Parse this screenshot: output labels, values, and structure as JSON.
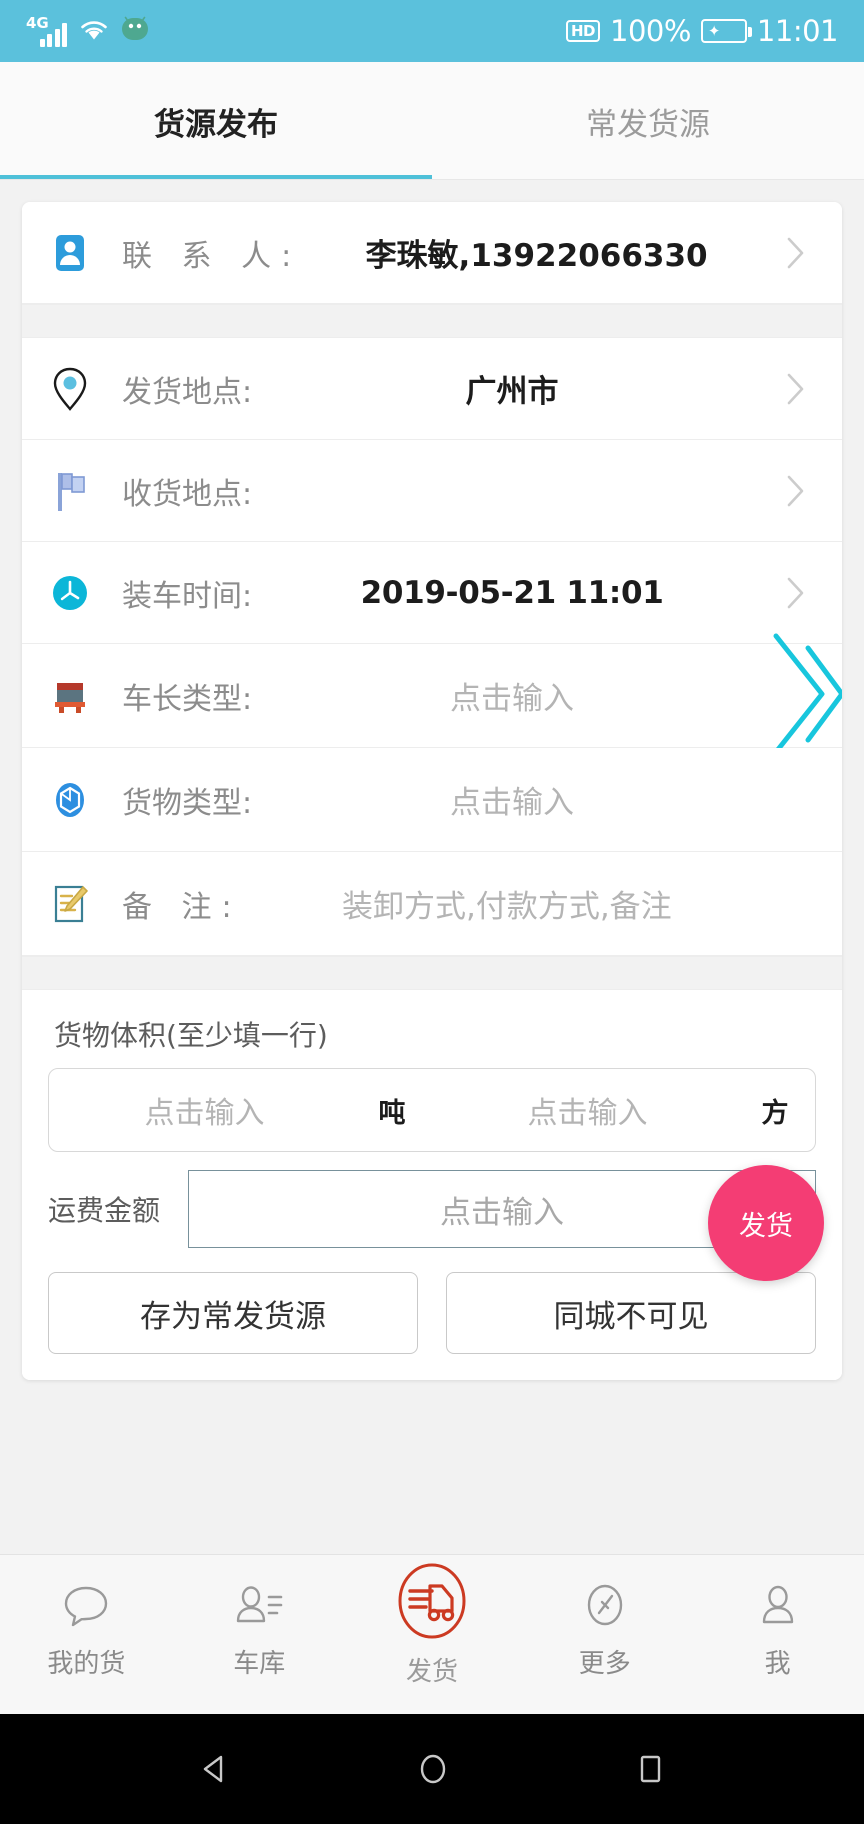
{
  "status_bar": {
    "network_type": "4G",
    "hd_label": "HD",
    "battery_percent": "100%",
    "time": "11:01",
    "icons": [
      "signal-icon",
      "wifi-icon",
      "android-robot-icon",
      "hd-icon",
      "battery-icon"
    ]
  },
  "tabs": [
    {
      "label": "货源发布",
      "active": true
    },
    {
      "label": "常发货源",
      "active": false
    }
  ],
  "form": {
    "rows": [
      {
        "icon": "contact-person-icon",
        "label": "联 系 人:",
        "value": "李珠敏,13922066330",
        "placeholder": "",
        "chevron": true
      },
      {
        "icon": "location-pin-icon",
        "label": "发货地点:",
        "value": "广州市",
        "placeholder": "",
        "chevron": true
      },
      {
        "icon": "flag-icon",
        "label": "收货地点:",
        "value": "",
        "placeholder": "",
        "chevron": true
      },
      {
        "icon": "clock-icon",
        "label": "装车时间:",
        "value": "2019-05-21 11:01",
        "placeholder": "",
        "chevron": true
      },
      {
        "icon": "truck-icon",
        "label": "车长类型:",
        "value": "",
        "placeholder": "点击输入",
        "chevron": false
      },
      {
        "icon": "cargo-box-icon",
        "label": "货物类型:",
        "value": "",
        "placeholder": "点击输入",
        "chevron": false
      },
      {
        "icon": "note-pencil-icon",
        "label": "备 注:",
        "value": "",
        "placeholder": "装卸方式,付款方式,备注",
        "chevron": false
      }
    ]
  },
  "volume": {
    "title": "货物体积(至少填一行)",
    "weight_placeholder": "点击输入",
    "weight_unit": "吨",
    "volume_placeholder": "点击输入",
    "volume_unit": "方"
  },
  "fee": {
    "label": "运费金额",
    "placeholder": "点击输入"
  },
  "actions": {
    "save_template": "存为常发货源",
    "hide_local": "同城不可见"
  },
  "fab": {
    "label": "发货",
    "color": "#f43d74"
  },
  "bottom_nav": [
    {
      "icon": "chat-bubble-icon",
      "label": "我的货",
      "active": false
    },
    {
      "icon": "garage-person-icon",
      "label": "车库",
      "active": false
    },
    {
      "icon": "truck-circle-icon",
      "label": "发货",
      "active": true
    },
    {
      "icon": "compass-icon",
      "label": "更多",
      "active": false
    },
    {
      "icon": "person-icon",
      "label": "我",
      "active": false
    }
  ],
  "android_nav": {
    "back": "back-triangle-icon",
    "home": "home-circle-icon",
    "recents": "recents-square-icon"
  },
  "colors": {
    "status_bar": "#5bc1dc",
    "tab_accent": "#4ec0d8",
    "fab_pink": "#f43d74",
    "active_nav_red": "#cc3a22"
  }
}
